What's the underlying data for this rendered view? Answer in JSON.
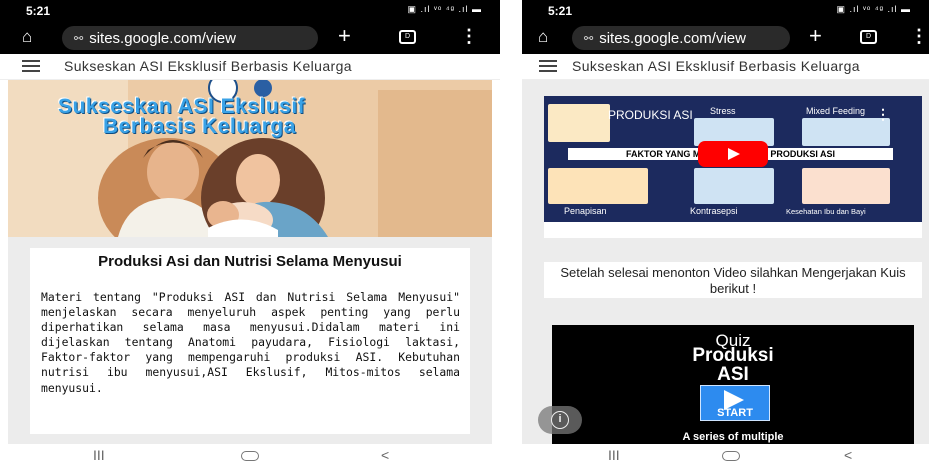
{
  "left": {
    "status": {
      "time": "5:21",
      "icons": "▣ .ıl ᵛᵒ ⁴ᵍ .ıl ▬"
    },
    "browser": {
      "url": "sites.google.com/view",
      "tab_icon": "D"
    },
    "site_title": "Sukseskan ASI Eksklusif Berbasis Keluarga",
    "hero": {
      "line1": "Sukseskan  ASI Ekslusif",
      "line2": "Berbasis Keluarga"
    },
    "card": {
      "title": "Produksi Asi dan Nutrisi Selama Menyusui",
      "body": "Materi tentang \"Produksi ASI dan Nutrisi Selama Menyusui\" menjelaskan secara menyeluruh aspek penting yang perlu diperhatikan selama masa menyusui.Didalam materi ini dijelaskan tentang Anatomi payudara, Fisiologi laktasi, Faktor-faktor yang mempengaruhi produksi ASI. Kebutuhan nutrisi ibu menyusui,ASI Ekslusif, Mitos-mitos selama menyusui."
    },
    "nav": {
      "recents": "III",
      "back": "<"
    }
  },
  "right": {
    "status": {
      "time": "5:21",
      "icons": "▣ .ıl ᵛᵒ ⁴ᵍ .ıl ▬"
    },
    "browser": {
      "url": "sites.google.com/view",
      "tab_icon": "D"
    },
    "site_title": "Sukseskan ASI Eksklusif Berbasis Keluarga",
    "video": {
      "title": "PRODUKSI ASI",
      "banner": "FAKTOR YANG MEMPENGARUHI PRODUKSI ASI",
      "labels": [
        "Stress",
        "Mixed Feeding",
        "Penapisan",
        "Kontrasepsi",
        "Kesehatan Ibu dan Bayi"
      ]
    },
    "instruction": "Setelah selesai menonton Video silahkan Mengerjakan Kuis berikut !",
    "quiz": {
      "line1": "Quiz",
      "line2": "Produksi",
      "line3": "ASI",
      "start": "START",
      "footer": "A series of multiple"
    },
    "info_icon": "i",
    "nav": {
      "recents": "III",
      "back": "<"
    }
  }
}
